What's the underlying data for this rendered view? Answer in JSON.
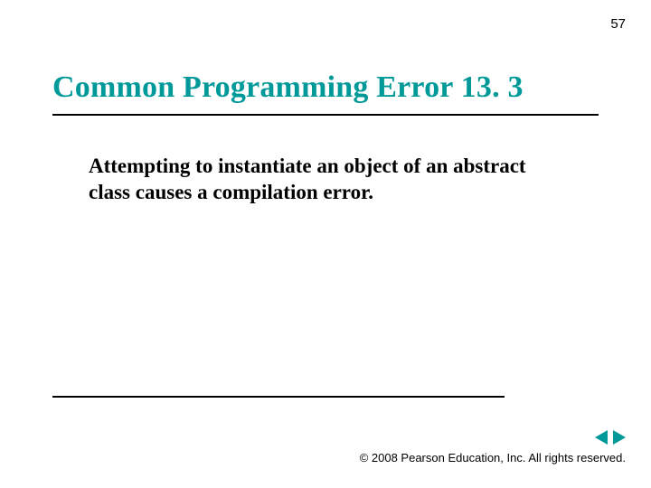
{
  "page_number": "57",
  "title": "Common Programming Error 13. 3",
  "body": "Attempting to instantiate an object of an abstract class causes a compilation error.",
  "footer": "© 2008 Pearson Education, Inc.  All rights reserved.",
  "colors": {
    "accent": "#009999"
  }
}
